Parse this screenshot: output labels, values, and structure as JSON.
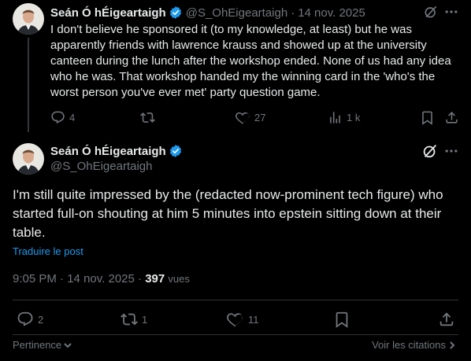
{
  "reply": {
    "author_name": "Seán Ó hÉigeartaigh",
    "handle": "@S_OhEigeartaigh",
    "separator": "·",
    "date": "14 nov. 2025",
    "text": "I don't believe he sponsored it (to my knowledge, at least) but he was apparently friends with lawrence krauss and showed up at the university canteen during the lunch after the workshop ended. None of us had any idea who he was. That workshop handed my the winning card in the 'who's the worst person you've ever met' party question game.",
    "replies": "4",
    "retweets": "",
    "likes": "27",
    "views": "1 k"
  },
  "main": {
    "author_name": "Seán Ó hÉigeartaigh",
    "handle": "@S_OhEigeartaigh",
    "text": "I'm still quite impressed by the (redacted now-prominent tech figure) who started full-on shouting at him 5 minutes into epstein sitting down at their table.",
    "translate_label": "Traduire le post",
    "time": "9:05 PM",
    "separator": "·",
    "date": "14 nov. 2025",
    "views_count": "397",
    "views_label": "vues",
    "replies": "2",
    "retweets": "1",
    "likes": "11"
  },
  "footer": {
    "relevance_label": "Pertinence",
    "quotes_label": "Voir les citations"
  },
  "colors": {
    "background": "#000000",
    "accent": "#1d9bf0",
    "muted": "#71767b",
    "text": "#e7e9ea"
  }
}
